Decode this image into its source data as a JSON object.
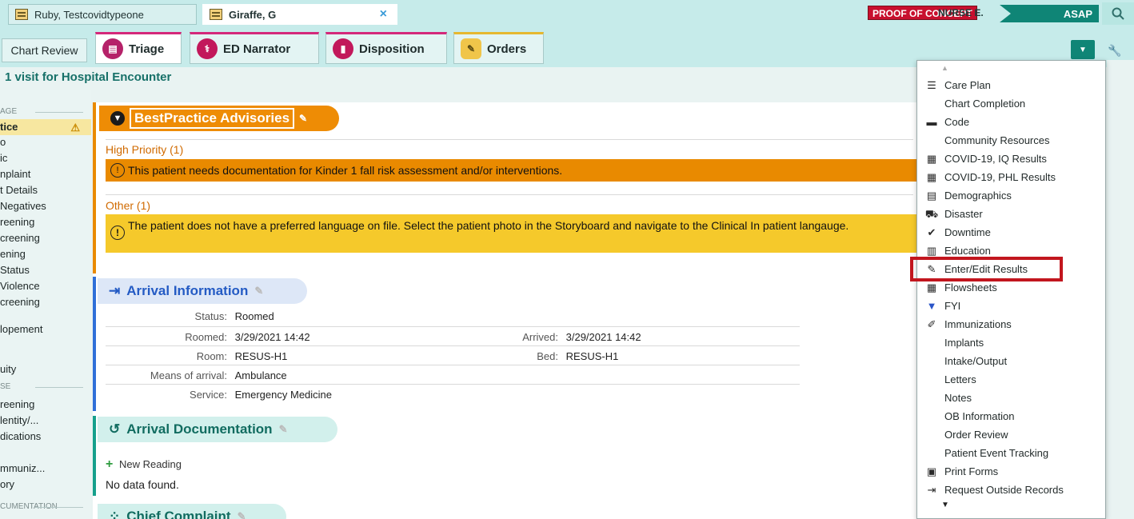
{
  "patient_tabs": [
    {
      "label": "Ruby, Testcovidtypeone"
    },
    {
      "label": "Giraffe, G",
      "close": "×"
    }
  ],
  "header": {
    "proof_of_concept": "PROOF OF CONCEPT",
    "nurse": "NURSE E.",
    "asap": "ASAP"
  },
  "activity_tabs": {
    "chart_review": "Chart Review",
    "triage": "Triage",
    "ed_narrator": "ED Narrator",
    "disposition": "Disposition",
    "orders": "Orders"
  },
  "visit_label": "1 visit for Hospital Encounter",
  "navigator": {
    "items": [
      {
        "label": "AGE",
        "type": "section"
      },
      {
        "label": "tice",
        "type": "item",
        "active": true,
        "warn": true
      },
      {
        "label": "o"
      },
      {
        "label": "ic"
      },
      {
        "label": "nplaint"
      },
      {
        "label": "t Details"
      },
      {
        "label": "Negatives"
      },
      {
        "label": "reening"
      },
      {
        "label": "creening"
      },
      {
        "label": "ening"
      },
      {
        "label": "Status"
      },
      {
        "label": "Violence"
      },
      {
        "label": "creening"
      },
      {
        "label": "lopement"
      },
      {
        "label": "uity"
      },
      {
        "label": "SE",
        "type": "section"
      },
      {
        "label": "reening"
      },
      {
        "label": "lentity/..."
      },
      {
        "label": "dications"
      },
      {
        "label": "mmuniz..."
      },
      {
        "label": "ory"
      },
      {
        "label": "CUMENTATION",
        "type": "section"
      }
    ]
  },
  "bpa": {
    "title": "BestPractice Advisories",
    "high_priority_label": "High Priority (1)",
    "high_priority_text": "This patient needs documentation for Kinder 1 fall risk assessment and/or interventions.",
    "other_label": "Other (1)",
    "other_text": "The patient does not have a preferred language on file. Select the patient photo in the Storyboard and navigate to the Clinical In patient langauge."
  },
  "arrival_info": {
    "title": "Arrival Information",
    "status_label": "Status:",
    "status": "Roomed",
    "roomed_label": "Roomed:",
    "roomed": "3/29/2021 14:42",
    "arrived_label": "Arrived:",
    "arrived": "3/29/2021 14:42",
    "room_label": "Room:",
    "room": "RESUS-H1",
    "bed_label": "Bed:",
    "bed": "RESUS-H1",
    "means_label": "Means of arrival:",
    "means": "Ambulance",
    "service_label": "Service:",
    "service": "Emergency Medicine"
  },
  "arrival_doc": {
    "title": "Arrival Documentation",
    "new_reading": "New Reading",
    "no_data": "No data found."
  },
  "chief_complaint": {
    "title": "Chief Complaint"
  },
  "menu": {
    "items": [
      {
        "label": "Care Plan",
        "icon": "checklist-icon"
      },
      {
        "label": "Chart Completion",
        "icon": ""
      },
      {
        "label": "Code",
        "icon": "code-icon"
      },
      {
        "label": "Community Resources",
        "icon": ""
      },
      {
        "label": "COVID-19, IQ Results",
        "icon": "results-icon"
      },
      {
        "label": "COVID-19, PHL Results",
        "icon": "results-icon"
      },
      {
        "label": "Demographics",
        "icon": "demographics-icon"
      },
      {
        "label": "Disaster",
        "icon": "disaster-icon"
      },
      {
        "label": "Downtime",
        "icon": "check-icon"
      },
      {
        "label": "Education",
        "icon": "education-icon"
      },
      {
        "label": "Enter/Edit Results",
        "icon": "pencil-icon",
        "highlighted": true
      },
      {
        "label": "Flowsheets",
        "icon": "grid-icon"
      },
      {
        "label": "FYI",
        "icon": "fyi-icon"
      },
      {
        "label": "Immunizations",
        "icon": "syringe-icon"
      },
      {
        "label": "Implants",
        "icon": ""
      },
      {
        "label": "Intake/Output",
        "icon": ""
      },
      {
        "label": "Letters",
        "icon": ""
      },
      {
        "label": "Notes",
        "icon": ""
      },
      {
        "label": "OB Information",
        "icon": ""
      },
      {
        "label": "Order Review",
        "icon": ""
      },
      {
        "label": "Patient Event Tracking",
        "icon": ""
      },
      {
        "label": "Print Forms",
        "icon": "print-icon"
      },
      {
        "label": "Request Outside Records",
        "icon": "import-icon"
      }
    ]
  },
  "colors": {
    "teal_header": "#c6ebea",
    "asap": "#0f8576",
    "bpa_orange": "#e98a00",
    "bpa_yellow": "#f5c92b",
    "arrival_blue": "#245bc4",
    "highlight_red": "#c2161e"
  }
}
